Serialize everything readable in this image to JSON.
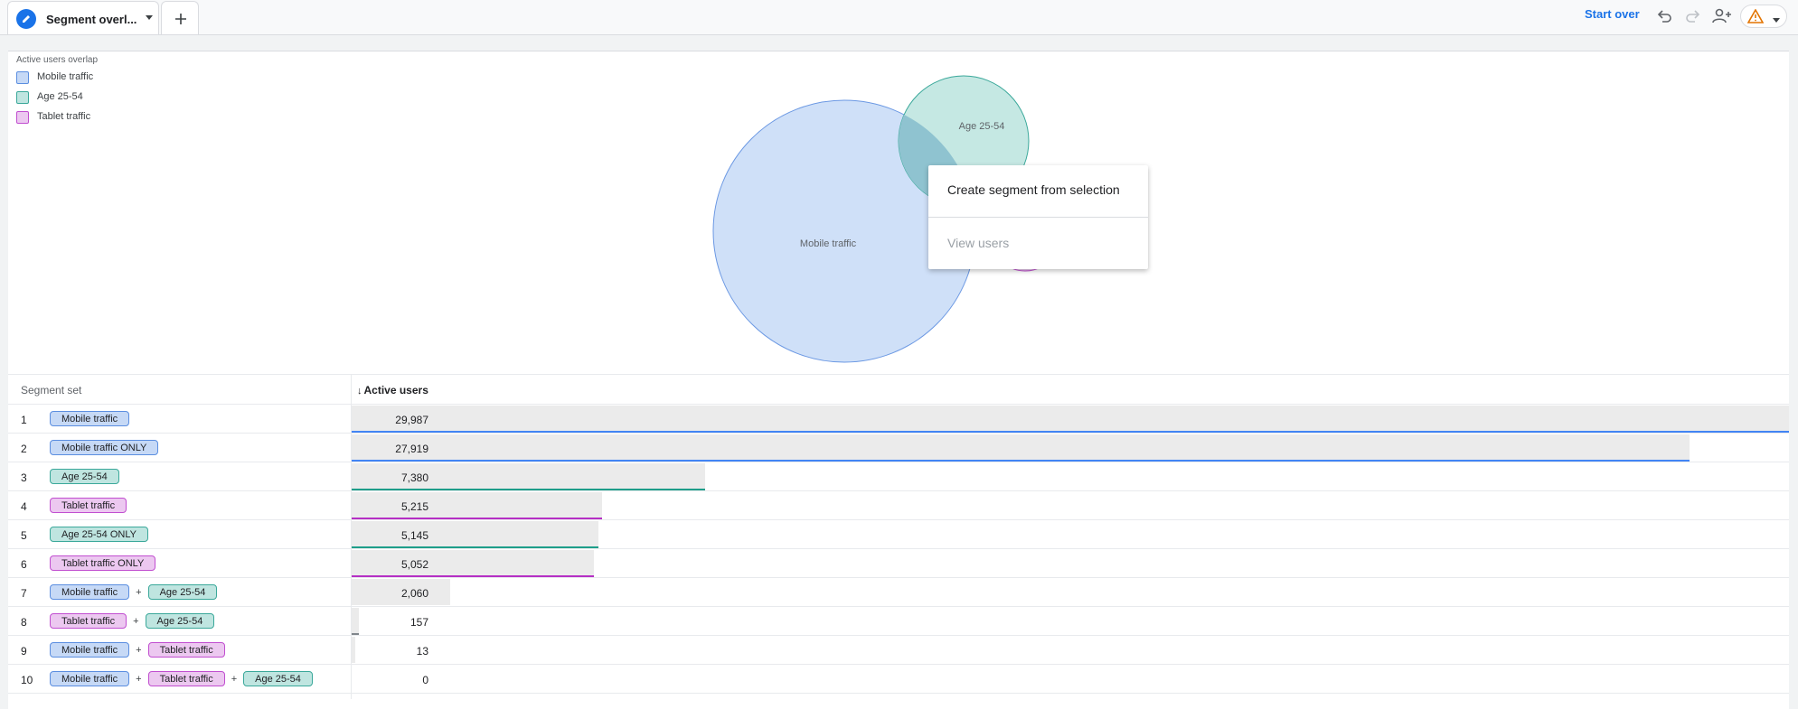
{
  "tab": {
    "label": "Segment overl...",
    "icon": "pencil-icon"
  },
  "toolbar": {
    "start_over": "Start over"
  },
  "legend": {
    "title": "Active users overlap",
    "items": [
      {
        "label": "Mobile traffic",
        "fill": "#c6d9f6",
        "stroke": "#5b8ee0"
      },
      {
        "label": "Age 25-54",
        "fill": "#bfe5e0",
        "stroke": "#3aa89a"
      },
      {
        "label": "Tablet traffic",
        "fill": "#ecc8f0",
        "stroke": "#c14ed0"
      }
    ]
  },
  "venn": {
    "mobile_label": "Mobile traffic",
    "age_label": "Age 25-54"
  },
  "context_menu": {
    "create": "Create segment from selection",
    "view": "View users"
  },
  "table": {
    "header_segment": "Segment set",
    "header_metric": "Active users",
    "sort_arrow": "↓",
    "max_value": 29987,
    "rows": [
      {
        "num": "1",
        "value": 29987,
        "value_label": "29,987",
        "line_color": "#4285f4",
        "pills": [
          {
            "text": "Mobile traffic",
            "type": "mobile"
          }
        ]
      },
      {
        "num": "2",
        "value": 27919,
        "value_label": "27,919",
        "line_color": "#4285f4",
        "pills": [
          {
            "text": "Mobile traffic ONLY",
            "type": "mobile"
          }
        ]
      },
      {
        "num": "3",
        "value": 7380,
        "value_label": "7,380",
        "line_color": "#1e9e8a",
        "pills": [
          {
            "text": "Age 25-54",
            "type": "age"
          }
        ]
      },
      {
        "num": "4",
        "value": 5215,
        "value_label": "5,215",
        "line_color": "#b52fc4",
        "pills": [
          {
            "text": "Tablet traffic",
            "type": "tablet"
          }
        ]
      },
      {
        "num": "5",
        "value": 5145,
        "value_label": "5,145",
        "line_color": "#1e9e8a",
        "pills": [
          {
            "text": "Age 25-54 ONLY",
            "type": "age"
          }
        ]
      },
      {
        "num": "6",
        "value": 5052,
        "value_label": "5,052",
        "line_color": "#b52fc4",
        "pills": [
          {
            "text": "Tablet traffic ONLY",
            "type": "tablet"
          }
        ]
      },
      {
        "num": "7",
        "value": 2060,
        "value_label": "2,060",
        "line_color": "",
        "pills": [
          {
            "text": "Mobile traffic",
            "type": "mobile"
          },
          {
            "text": "Age 25-54",
            "type": "age"
          }
        ]
      },
      {
        "num": "8",
        "value": 157,
        "value_label": "157",
        "line_color": "#80868b",
        "pills": [
          {
            "text": "Tablet traffic",
            "type": "tablet"
          },
          {
            "text": "Age 25-54",
            "type": "age"
          }
        ]
      },
      {
        "num": "9",
        "value": 13,
        "value_label": "13",
        "line_color": "",
        "pills": [
          {
            "text": "Mobile traffic",
            "type": "mobile"
          },
          {
            "text": "Tablet traffic",
            "type": "tablet"
          }
        ]
      },
      {
        "num": "10",
        "value": 0,
        "value_label": "0",
        "line_color": "",
        "pills": [
          {
            "text": "Mobile traffic",
            "type": "mobile"
          },
          {
            "text": "Tablet traffic",
            "type": "tablet"
          },
          {
            "text": "Age 25-54",
            "type": "age"
          }
        ]
      }
    ]
  }
}
